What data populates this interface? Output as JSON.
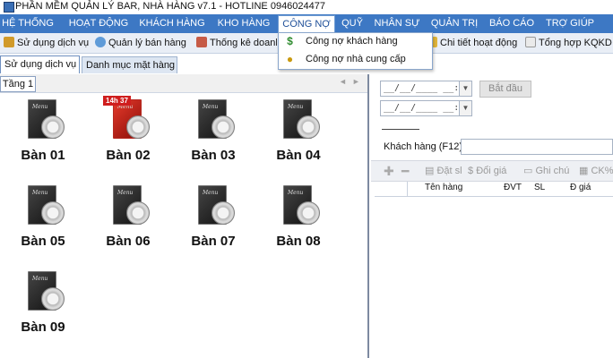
{
  "window": {
    "title": "PHẦN MỀM QUẢN LÝ BAR, NHÀ HÀNG v7.1 - HOTLINE 0946024477"
  },
  "menu": [
    "HỆ THỐNG",
    "HOẠT ĐỘNG",
    "KHÁCH HÀNG",
    "KHO HÀNG",
    "CÔNG NỢ",
    "QUỸ",
    "NHÂN SỰ",
    "QUẢN TRỊ",
    "BÁO CÁO",
    "TRỢ GIÚP"
  ],
  "toolbar": {
    "items": [
      "Sử dụng dịch vụ",
      "Quản lý bán hàng",
      "Thống kê doanh",
      "Chi tiết hoạt động",
      "Tổng hợp KQKD"
    ],
    "icons": [
      "service-icon",
      "sales-manage-icon",
      "stats-icon",
      "activity-detail-icon",
      "summary-icon"
    ]
  },
  "dropdown": {
    "items": [
      "Công nợ khách hàng",
      "Công nợ nhà cung cấp"
    ],
    "icons": [
      "dollar-icon",
      "coins-icon"
    ]
  },
  "tabs": [
    "Sử dụng dịch vụ",
    "Danh mục mặt hàng"
  ],
  "floor": {
    "label": "Tầng 1"
  },
  "tables": [
    {
      "name": "Bàn 01",
      "busy": false,
      "timer": ""
    },
    {
      "name": "Bàn 02",
      "busy": true,
      "timer": "14h 37"
    },
    {
      "name": "Bàn 03",
      "busy": false,
      "timer": ""
    },
    {
      "name": "Bàn 04",
      "busy": false,
      "timer": ""
    },
    {
      "name": "Bàn 05",
      "busy": false,
      "timer": ""
    },
    {
      "name": "Bàn 06",
      "busy": false,
      "timer": ""
    },
    {
      "name": "Bàn 07",
      "busy": false,
      "timer": ""
    },
    {
      "name": "Bàn 08",
      "busy": false,
      "timer": ""
    },
    {
      "name": "Bàn 09",
      "busy": false,
      "timer": ""
    }
  ],
  "table_icon_text": "Menu",
  "right": {
    "date_placeholder": "__/__/____ __:__",
    "start_button": "Bắt đầu",
    "customer_label": "Khách hàng (F12)",
    "grid_toolbar": [
      "Đặt sl",
      "Đổi giá",
      "Ghi chú",
      "CK%"
    ],
    "grid_columns": [
      "Tên hàng",
      "ĐVT",
      "SL",
      "Đ giá"
    ]
  },
  "colors": {
    "menubar": "#3d78c4",
    "busy": "#cf1e1e"
  }
}
